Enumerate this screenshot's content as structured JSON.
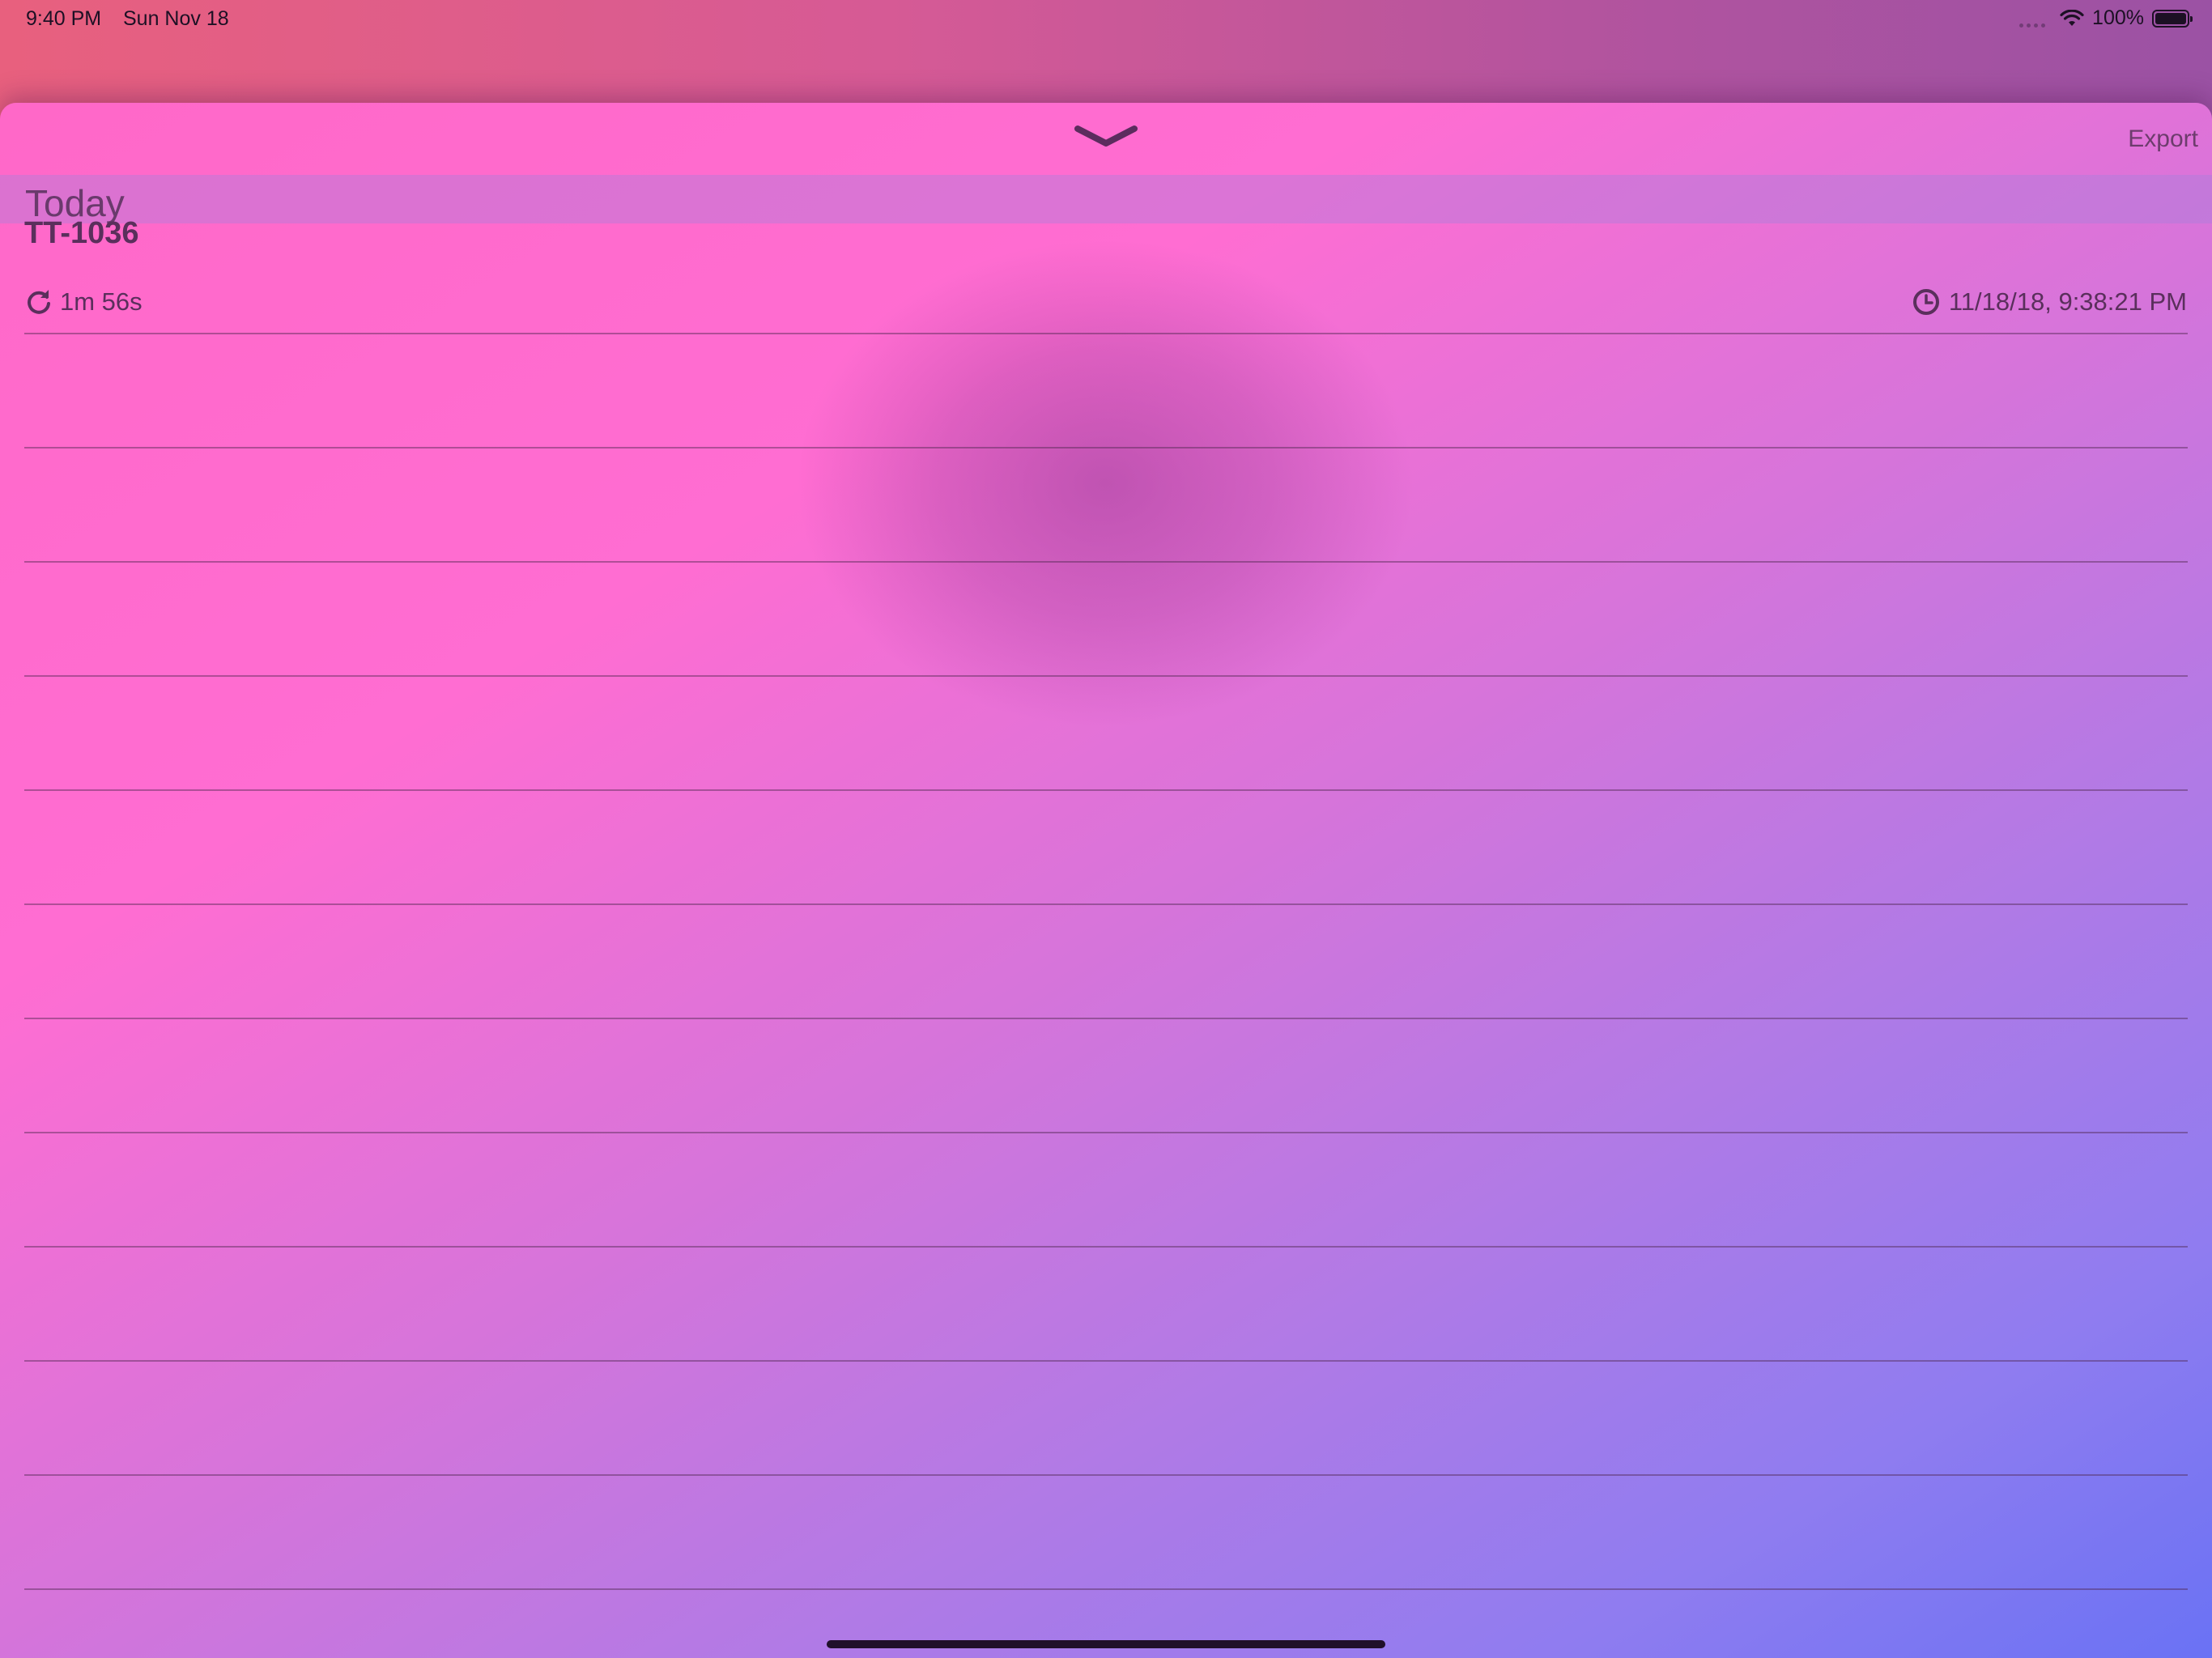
{
  "status_bar": {
    "time": "9:40 PM",
    "date": "Sun Nov 18",
    "battery": "100%"
  },
  "sheet": {
    "chevron_icon": "chevron-down-icon",
    "export_label": "Export"
  },
  "section": {
    "title": "Today"
  },
  "entry": {
    "title": "TT-1036",
    "duration": "1m 56s",
    "timestamp": "11/18/18, 9:38:21 PM",
    "duration_icon": "refresh-icon",
    "timestamp_icon": "clock-icon"
  },
  "colors": {
    "accent_text": "#5a2f5c",
    "sheet_top": "#ff68c8",
    "sheet_bottom": "#6a72f4"
  }
}
